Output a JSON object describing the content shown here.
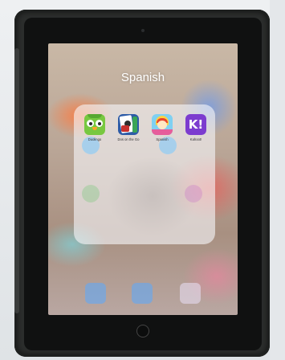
{
  "folder": {
    "title": "Spanish",
    "apps": [
      {
        "label": "Duolingo",
        "icon": "duolingo-owl-icon"
      },
      {
        "label": "Dos on the Go",
        "icon": "cards-app-icon"
      },
      {
        "label": "Spanish",
        "icon": "spanish-kids-app-icon"
      },
      {
        "label": "Kahoot!",
        "icon": "kahoot-icon",
        "glyph": "K!"
      }
    ]
  },
  "colors": {
    "case": "#2c2e2d",
    "bezel": "#101111",
    "folder_background": "rgba(245,245,248,0.62)",
    "kahoot": "#7c3ccf",
    "duolingo": "#78c840"
  }
}
